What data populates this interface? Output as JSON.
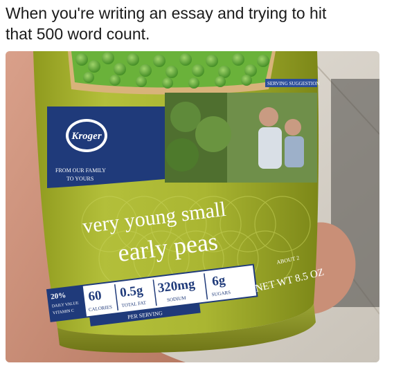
{
  "caption": {
    "line1": "When you're writing an essay and trying to hit",
    "line2": "that 500 word count."
  },
  "photo": {
    "brand_logo": "Kroger",
    "tagline_line1": "FROM OUR FAMILY",
    "tagline_line2": "TO YOURS",
    "serving_tab": "SERVING SUGGESTION",
    "product_line1": "very young small",
    "product_line2": "early peas",
    "nutrition": {
      "vitamin_pct": "20%",
      "vitamin_sub1": "DAILY VALUE",
      "vitamin_sub2": "VITAMIN C",
      "calories_value": "60",
      "calories_label": "CALORIES",
      "fat_value": "0.5g",
      "fat_label": "TOTAL FAT",
      "sodium_value": "320mg",
      "sodium_label": "SODIUM",
      "sugars_value": "6g",
      "sugars_label": "SUGARS",
      "per_serving": "PER SERVING"
    },
    "about_label": "ABOUT 2",
    "net_weight": "NET WT 8.5 OZ",
    "colors": {
      "label_green": "#a8b52e",
      "brand_navy": "#1f3a7a",
      "pea_green": "#5aa332"
    }
  }
}
